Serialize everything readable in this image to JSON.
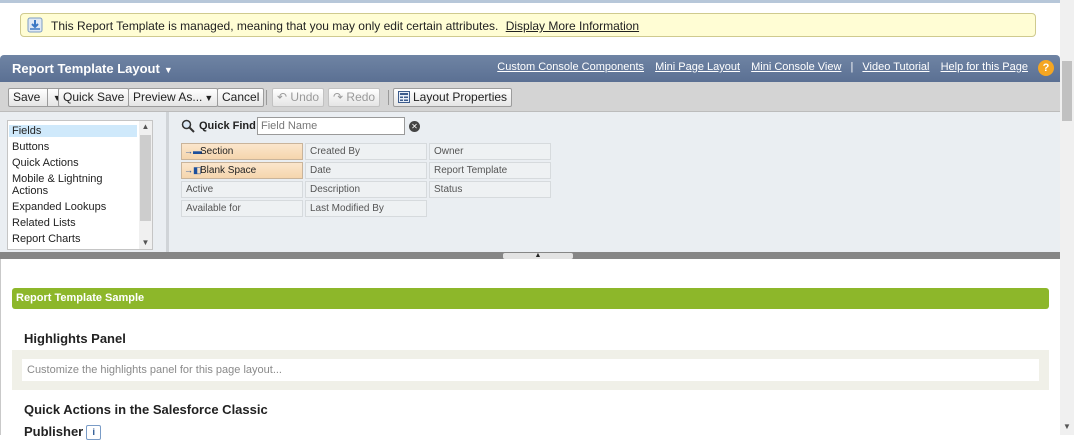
{
  "notice": {
    "text": "This Report Template is managed, meaning that you may only edit certain attributes.",
    "link": "Display More Information"
  },
  "header": {
    "title": "Report Template Layout",
    "links": [
      "Custom Console Components",
      "Mini Page Layout",
      "Mini Console View",
      "Video Tutorial",
      "Help for this Page"
    ],
    "separator": "|",
    "help_icon": "?"
  },
  "toolbar": {
    "save": "Save",
    "quick_save": "Quick Save",
    "preview_as": "Preview As...",
    "cancel": "Cancel",
    "undo": "Undo",
    "redo": "Redo",
    "layout_properties": "Layout Properties"
  },
  "palette": {
    "categories": [
      "Fields",
      "Buttons",
      "Quick Actions",
      "Mobile & Lightning Actions",
      "Expanded Lookups",
      "Related Lists",
      "Report Charts"
    ],
    "quick_find_label": "Quick Find",
    "quick_find_placeholder": "Field Name",
    "fields": {
      "col1": [
        "Section",
        "Blank Space",
        "Active",
        "Available for"
      ],
      "col2": [
        "Created By",
        "Date",
        "Description",
        "Last Modified By"
      ],
      "col3": [
        "Owner",
        "Report Template",
        "Status"
      ]
    }
  },
  "layout": {
    "section_bar": "Report Template Sample",
    "highlights_title": "Highlights Panel",
    "highlights_hint": "Customize the highlights panel for this page layout...",
    "quick_actions_title_line1": "Quick Actions in the Salesforce Classic",
    "quick_actions_title_line2": "Publisher",
    "info_icon": "i"
  },
  "colors": {
    "header_bg": "#6a7fa0",
    "section_bar": "#8db72a",
    "notice_bg": "#fffdd4",
    "help_icon": "#f4a623"
  }
}
